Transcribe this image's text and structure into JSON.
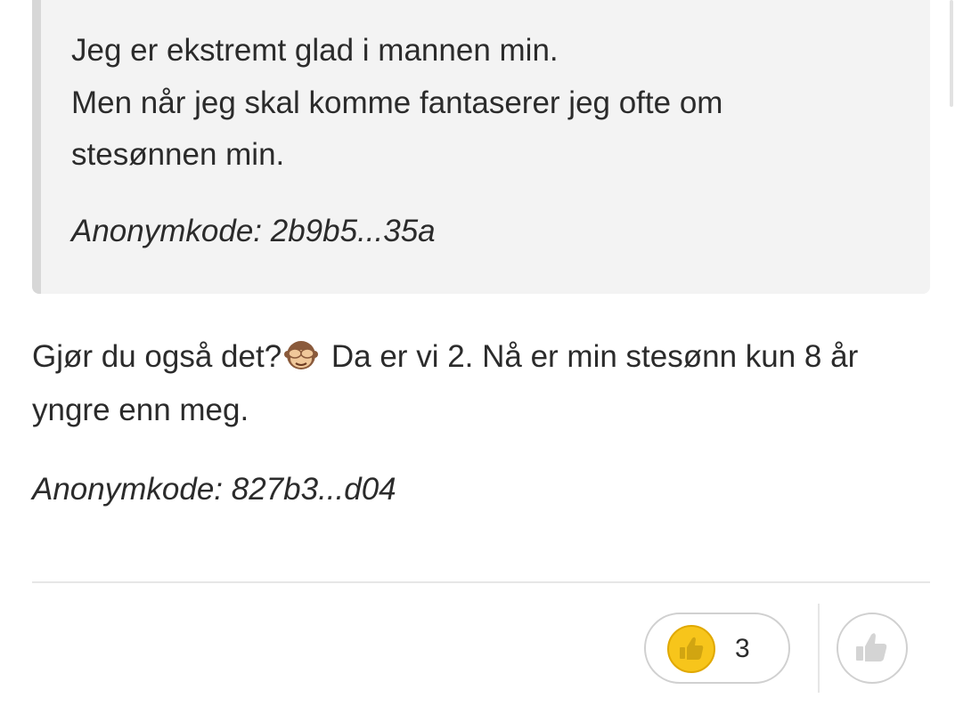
{
  "quote": {
    "lines": [
      "Jeg er ekstremt glad i mannen min.",
      "Men når jeg skal komme fantaserer jeg ofte om",
      "stesønnen min."
    ],
    "anon_code": "Anonymkode: 2b9b5...35a"
  },
  "reply": {
    "line1_before": "Gjør du også det?",
    "line1_emoji": "see-no-evil-monkey",
    "line1_after": " Da er vi 2. Nå er min stesønn kun 8 år",
    "line2": "yngre enn meg.",
    "anon_code": "Anonymkode: 827b3...d04"
  },
  "reactions": {
    "like_icon": "thumbs-up-icon",
    "like_count": "3",
    "add_reaction_icon": "thumbs-up-outline-icon",
    "colors": {
      "like_fill": "#f7c51b",
      "border": "#d0d0d0"
    }
  }
}
